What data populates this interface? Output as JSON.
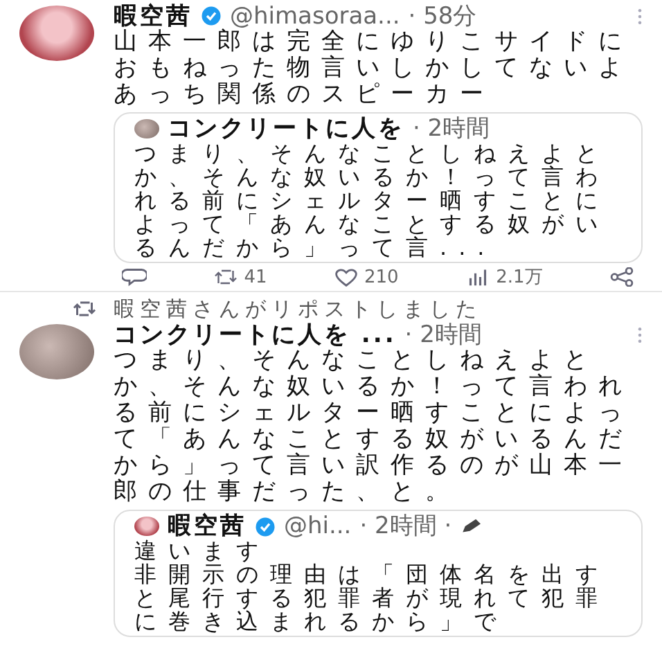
{
  "posts": [
    {
      "kind": "post",
      "author": {
        "name": "暇空茜",
        "verified": true,
        "handle": "@himasoraa...",
        "time": "· 58分"
      },
      "text": "山本一郎は完全にゆりこサイドにおもねった物言いしかしてないよあっち関係のスピーカー",
      "quote": {
        "author": {
          "name": "コンクリートに人を",
          "verified": false,
          "time": "· 2時間",
          "edited": false
        },
        "text": [
          "つまり、そんなことしねえよとか、そんな奴いるか！って言われる前にシェルター晒すことによって「あんなことする奴がいるんだから」って言..."
        ]
      },
      "actions": {
        "retweets": "41",
        "likes": "210",
        "views": "2.1万"
      }
    },
    {
      "kind": "repost",
      "repost_by": "暇空茜さんがリポストしました",
      "author": {
        "name": "コンクリートに人を ...",
        "verified": false,
        "time": "· 2時間"
      },
      "text": "つまり、そんなことしねえよとか、そんな奴いるか！って言われる前にシェルター晒すことによって「あんなことする奴がいるんだから」って言い訳作るのが山本一郎の仕事だった、と。",
      "quote": {
        "author": {
          "name": "暇空茜",
          "verified": true,
          "handle": "@hi...",
          "time": "· 2時間 ·",
          "edited": true
        },
        "text": [
          "違います",
          "非開示の理由は「団体名を出すと尾行する犯罪者が現れて犯罪に巻き込まれるから」で"
        ]
      }
    }
  ]
}
